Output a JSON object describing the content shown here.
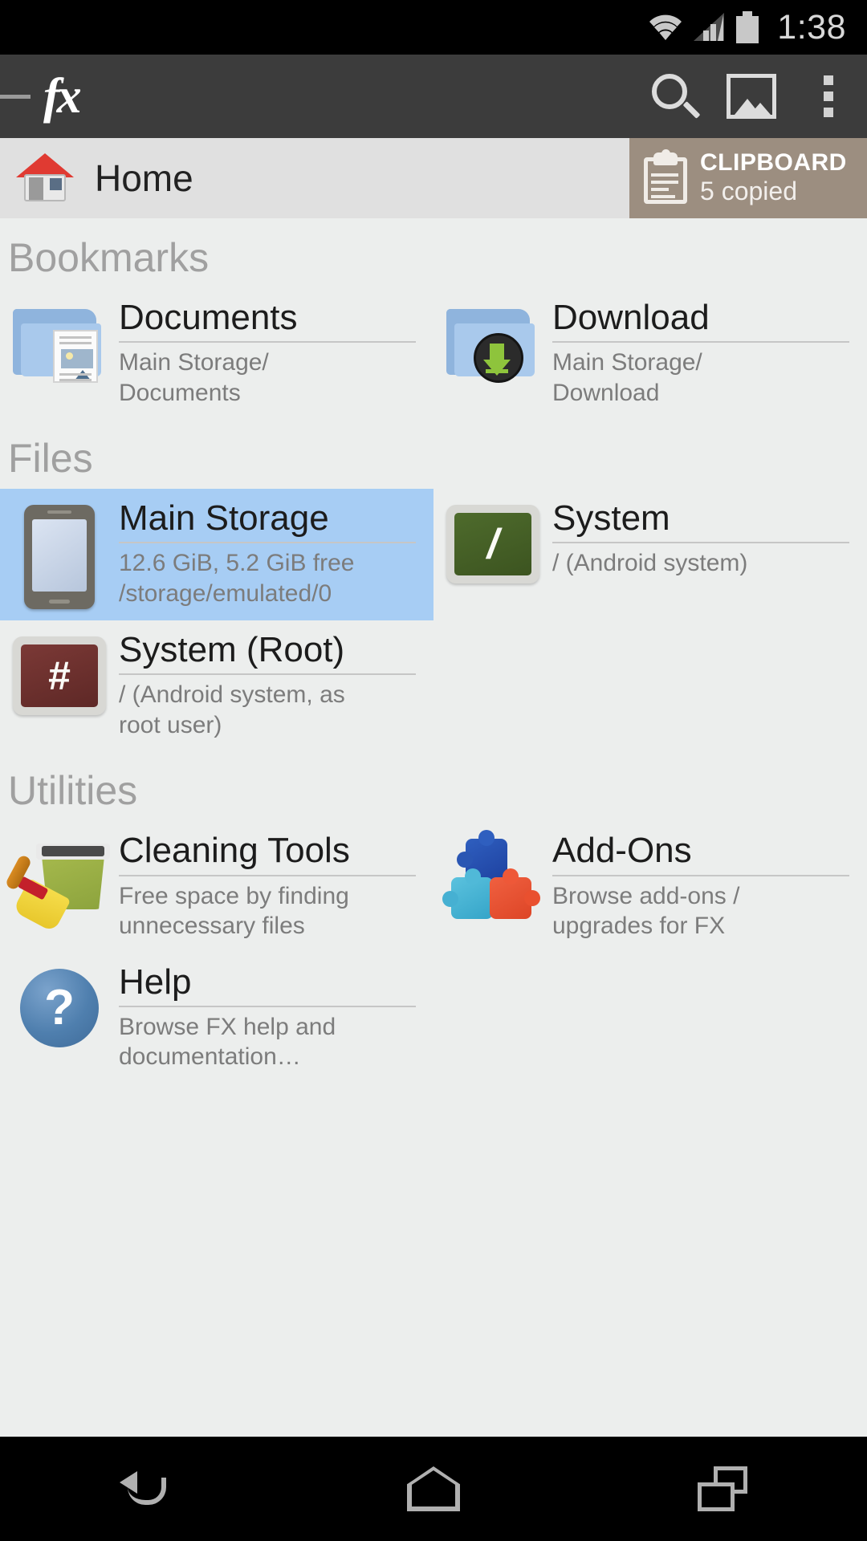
{
  "status_bar": {
    "clock": "1:38",
    "icons": [
      "wifi-icon",
      "signal-icon",
      "battery-icon"
    ]
  },
  "action_bar": {
    "app_logo": "fx",
    "drawer_label": "",
    "icons": [
      {
        "name": "search-icon",
        "label": "Search"
      },
      {
        "name": "image-icon",
        "label": "Gallery"
      },
      {
        "name": "overflow-menu-icon",
        "label": "More options"
      }
    ]
  },
  "breadcrumb": {
    "label": "Home",
    "icon": "home-icon"
  },
  "clipboard": {
    "title": "CLIPBOARD",
    "subtitle": "5 copied",
    "background_color": "#9c8e80",
    "icon": "clipboard-icon"
  },
  "sections": [
    {
      "title": "Bookmarks",
      "items": [
        {
          "title": "Documents",
          "subtitle": "Main Storage/\nDocuments",
          "icon": "folder-documents-icon",
          "selected": false
        },
        {
          "title": "Download",
          "subtitle": "Main Storage/\nDownload",
          "icon": "folder-download-icon",
          "selected": false
        }
      ]
    },
    {
      "title": "Files",
      "items": [
        {
          "title": "Main Storage",
          "subtitle": "12.6 GiB, 5.2 GiB free\n/storage/emulated/0",
          "icon": "phone-icon",
          "selected": true
        },
        {
          "title": "System",
          "subtitle": "/ (Android system)",
          "icon": "terminal-green-icon",
          "selected": false
        },
        {
          "title": "System (Root)",
          "subtitle": "/ (Android system, as\nroot user)",
          "icon": "terminal-red-icon",
          "selected": false
        }
      ]
    },
    {
      "title": "Utilities",
      "items": [
        {
          "title": "Cleaning Tools",
          "subtitle": "Free space by finding\nunnecessary files",
          "icon": "cleaning-tools-icon",
          "selected": false
        },
        {
          "title": "Add-Ons",
          "subtitle": "Browse add-ons /\nupgrades for FX",
          "icon": "puzzle-icon",
          "selected": false
        },
        {
          "title": "Help",
          "subtitle": "Browse FX help and\ndocumentation…",
          "icon": "help-icon",
          "selected": false
        }
      ]
    }
  ],
  "nav_bar": {
    "buttons": [
      {
        "name": "back-button",
        "label": "Back"
      },
      {
        "name": "home-button",
        "label": "Home"
      },
      {
        "name": "recents-button",
        "label": "Recents"
      }
    ]
  },
  "colors": {
    "action_bar": "#3c3c3c",
    "breadcrumb_bar": "#e0e0e0",
    "page_background": "#eceeed",
    "selection": "#a7cdf4",
    "clipboard": "#9c8e80",
    "section_header_text": "#a0a0a0",
    "title_text": "#1c1c1c",
    "subtitle_text": "#7c7c7c"
  },
  "terminal_glyphs": {
    "system": "/",
    "system_root": "#"
  },
  "help_glyph": "?"
}
